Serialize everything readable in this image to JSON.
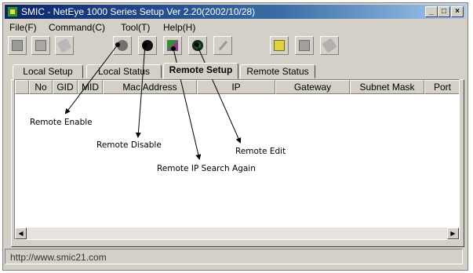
{
  "window": {
    "title": "SMIC - NetEye 1000 Series Setup Ver 2.20(2002/10/28)",
    "controls": [
      "_",
      "□",
      "×"
    ]
  },
  "menu": [
    "File(F)",
    "Command(C)",
    "Tool(T)",
    "Help(H)"
  ],
  "toolbar": {
    "buttons": [
      {
        "name": "toolbar-button-1-icon"
      },
      {
        "name": "toolbar-button-2-icon"
      },
      {
        "name": "toolbar-button-3-icon"
      },
      {
        "name": "remote-enable-icon"
      },
      {
        "name": "remote-disable-icon"
      },
      {
        "name": "remote-ip-search-icon"
      },
      {
        "name": "remote-edit-icon"
      },
      {
        "name": "pencil-icon"
      },
      {
        "name": "folder-icon"
      },
      {
        "name": "save-icon"
      },
      {
        "name": "tool-icon"
      }
    ]
  },
  "tabs": [
    "Local Setup",
    "Local Status",
    "Remote Setup",
    "Remote Status"
  ],
  "active_tab": "Remote Setup",
  "columns": [
    "No",
    "GID",
    "MID",
    "Mac Address",
    "IP",
    "Gateway",
    "Subnet Mask",
    "Port"
  ],
  "annotations": {
    "remote_enable": "Remote Enable",
    "remote_disable": "Remote Disable",
    "remote_ip_search": "Remote IP Search Again",
    "remote_edit": "Remote Edit"
  },
  "status": {
    "url": "http://www.smic21.com"
  },
  "colors": {
    "titlebar_start": "#0a246a",
    "face": "#d4d0c8"
  }
}
